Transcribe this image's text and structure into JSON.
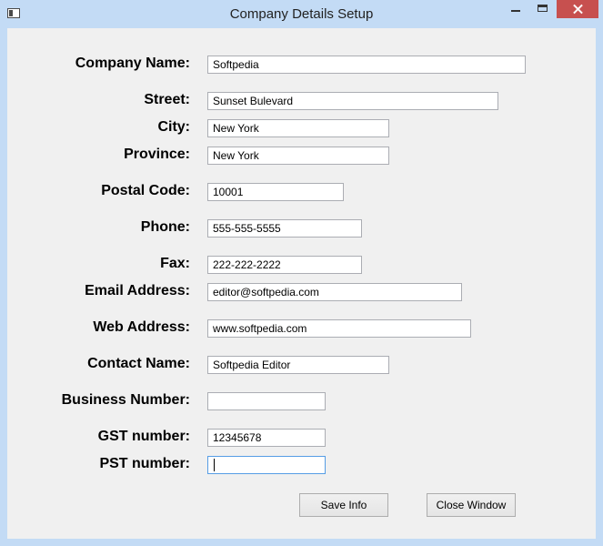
{
  "window": {
    "title": "Company Details Setup"
  },
  "form": {
    "fields": [
      {
        "label": "Company Name:",
        "value": "Softpedia"
      },
      {
        "label": "Street:",
        "value": "Sunset Bulevard"
      },
      {
        "label": "City:",
        "value": "New York"
      },
      {
        "label": "Province:",
        "value": "New York"
      },
      {
        "label": "Postal Code:",
        "value": "10001"
      },
      {
        "label": "Phone:",
        "value": "555-555-5555"
      },
      {
        "label": "Fax:",
        "value": "222-222-2222"
      },
      {
        "label": "Email Address:",
        "value": "editor@softpedia.com"
      },
      {
        "label": "Web Address:",
        "value": "www.softpedia.com"
      },
      {
        "label": "Contact Name:",
        "value": "Softpedia Editor"
      },
      {
        "label": "Business Number:",
        "value": ""
      },
      {
        "label": "GST number:",
        "value": "12345678"
      },
      {
        "label": "PST number:",
        "value": ""
      }
    ]
  },
  "buttons": {
    "save": "Save Info",
    "close": "Close Window"
  }
}
